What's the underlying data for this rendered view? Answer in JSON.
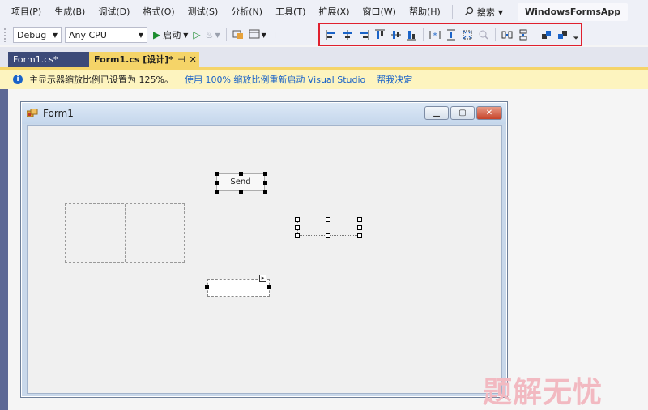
{
  "menu": {
    "items": [
      "项目(P)",
      "生成(B)",
      "调试(D)",
      "格式(O)",
      "测试(S)",
      "分析(N)",
      "工具(T)",
      "扩展(X)",
      "窗口(W)",
      "帮助(H)"
    ],
    "search_label": "搜索",
    "app_title": "WindowsFormsApp"
  },
  "toolbar": {
    "config": "Debug",
    "platform": "Any CPU",
    "start_label": "启动"
  },
  "tabs": [
    {
      "label": "Form1.cs*"
    },
    {
      "label": "Form1.cs [设计]*"
    }
  ],
  "infobar": {
    "message": "主显示器缩放比例已设置为 125%。",
    "link_restart": "使用 100% 缩放比例重新启动 Visual Studio",
    "link_help": "帮我决定"
  },
  "form": {
    "title": "Form1",
    "button_text": "Send"
  },
  "watermark": "题解无忧",
  "colors": {
    "highlight_box": "#e0202e",
    "tab_active": "#f5d468",
    "tab_inactive": "#3c4a78",
    "infobar_bg": "#fdf4bf",
    "link": "#1a63c8"
  }
}
